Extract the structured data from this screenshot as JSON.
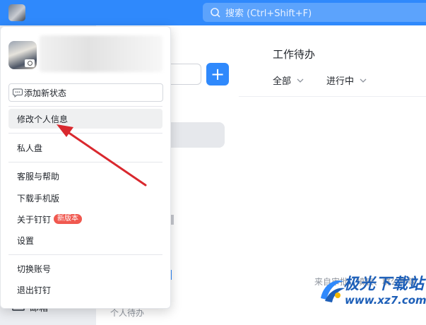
{
  "search": {
    "placeholder": "搜索 (Ctrl+Shift+F)"
  },
  "work": {
    "title": "工作待办",
    "filters": [
      {
        "label": "全部"
      },
      {
        "label": "进行中"
      }
    ],
    "footer": "来自审批、填表、群公告等"
  },
  "midpane": {
    "bottom_text": "个人待办"
  },
  "leftnav": {
    "bottom_label": "邮箱"
  },
  "menu": {
    "add_status": "添加新状态",
    "items": [
      {
        "label": "修改个人信息"
      },
      {
        "label": "私人盘"
      },
      {
        "label": "客服与帮助"
      },
      {
        "label": "下载手机版"
      },
      {
        "label": "关于钉钉",
        "badge": "新版本"
      },
      {
        "label": "设置"
      },
      {
        "label": "切换账号"
      },
      {
        "label": "退出钉钉"
      }
    ]
  },
  "watermark": {
    "title": "极光下载站",
    "url": "www.xz7.com"
  },
  "colors": {
    "brand": "#2f89fc",
    "badge": "#f0584f",
    "annotation_arrow": "#d9282e"
  }
}
